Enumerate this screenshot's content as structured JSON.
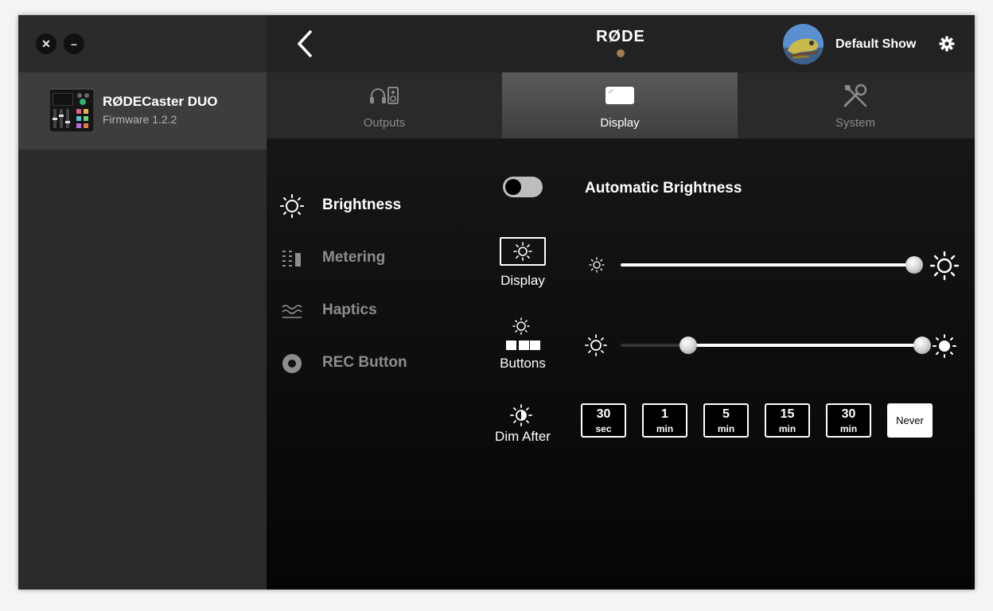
{
  "window": {
    "close_label": "✕",
    "minimize_label": "–"
  },
  "sidebar": {
    "device": {
      "name": "RØDECaster DUO",
      "firmware": "Firmware 1.2.2"
    }
  },
  "header": {
    "logo": "RØDE",
    "show_name": "Default Show"
  },
  "tabs": [
    {
      "label": "Outputs",
      "icon": "headphones-speaker-icon"
    },
    {
      "label": "Display",
      "icon": "display-icon",
      "active": true
    },
    {
      "label": "System",
      "icon": "tools-icon"
    }
  ],
  "submenu": [
    {
      "label": "Brightness",
      "icon": "sun-icon",
      "active": true
    },
    {
      "label": "Metering",
      "icon": "meter-icon"
    },
    {
      "label": "Haptics",
      "icon": "haptics-icon"
    },
    {
      "label": "REC Button",
      "icon": "rec-icon"
    }
  ],
  "panel": {
    "auto_brightness": {
      "label": "Automatic Brightness",
      "enabled": false
    },
    "display": {
      "label": "Display",
      "level": 1.0
    },
    "buttons": {
      "label": "Buttons",
      "range": [
        0.2,
        1.0
      ]
    },
    "dim_after": {
      "label": "Dim After",
      "options": [
        {
          "value": "30",
          "unit": "sec"
        },
        {
          "value": "1",
          "unit": "min"
        },
        {
          "value": "5",
          "unit": "min"
        },
        {
          "value": "15",
          "unit": "min"
        },
        {
          "value": "30",
          "unit": "min"
        },
        {
          "value": "Never",
          "unit": ""
        }
      ],
      "selected": "Never"
    }
  },
  "colors": {
    "accent_dot": "#a47a52",
    "active_tab": "#4d4d4d"
  }
}
